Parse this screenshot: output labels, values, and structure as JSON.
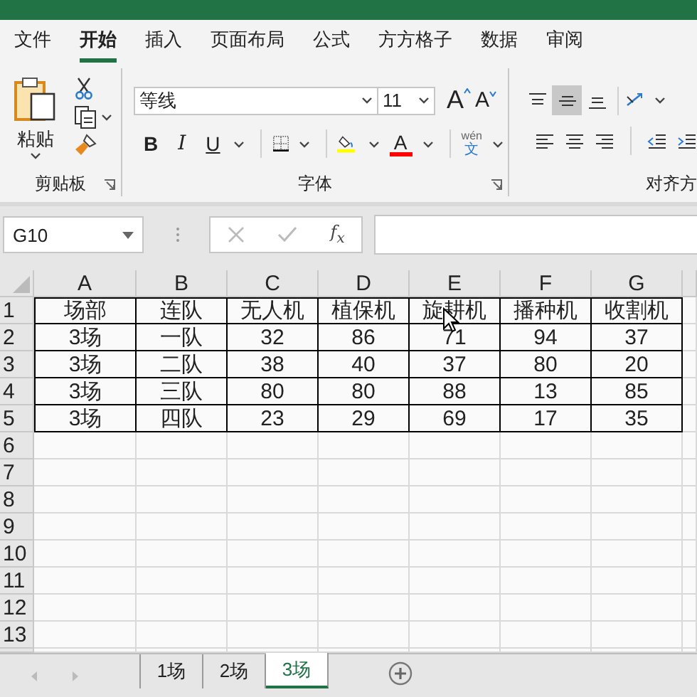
{
  "menu_tabs": [
    {
      "label": "文件",
      "selected": false
    },
    {
      "label": "开始",
      "selected": true
    },
    {
      "label": "插入",
      "selected": false
    },
    {
      "label": "页面布局",
      "selected": false
    },
    {
      "label": "公式",
      "selected": false
    },
    {
      "label": "方方格子",
      "selected": false
    },
    {
      "label": "数据",
      "selected": false
    },
    {
      "label": "审阅",
      "selected": false
    }
  ],
  "ribbon": {
    "clipboard": {
      "paste_label": "粘贴",
      "group_label": "剪贴板"
    },
    "font": {
      "font_name": "等线",
      "font_size": "11",
      "grow_label": "A",
      "shrink_label": "A",
      "bold_label": "B",
      "italic_label": "I",
      "underline_label": "U",
      "font_color_label": "A",
      "phonetic_top": "wén",
      "phonetic_bottom": "文",
      "group_label": "字体"
    },
    "alignment": {
      "vertical": [
        {
          "kind": "top",
          "selected": false
        },
        {
          "kind": "middle",
          "selected": true
        },
        {
          "kind": "bottom",
          "selected": false
        }
      ],
      "group_label": "对齐方"
    }
  },
  "formula_bar": {
    "name_box": "G10",
    "fx_label": "f$_{x}$"
  },
  "sheet": {
    "columns": [
      "A",
      "B",
      "C",
      "D",
      "E",
      "F",
      "G"
    ],
    "row_headers": [
      "1",
      "2",
      "3",
      "4",
      "5",
      "6",
      "7",
      "8",
      "9",
      "10",
      "11",
      "12",
      "13"
    ],
    "rows": [
      [
        "场部",
        "连队",
        "无人机",
        "植保机",
        "旋耕机",
        "播种机",
        "收割机"
      ],
      [
        "3场",
        "一队",
        "32",
        "86",
        "71",
        "94",
        "37"
      ],
      [
        "3场",
        "二队",
        "38",
        "40",
        "37",
        "80",
        "20"
      ],
      [
        "3场",
        "三队",
        "80",
        "80",
        "88",
        "13",
        "85"
      ],
      [
        "3场",
        "四队",
        "23",
        "29",
        "69",
        "17",
        "35"
      ]
    ]
  },
  "sheet_tabs": [
    {
      "label": "1场",
      "selected": false
    },
    {
      "label": "2场",
      "selected": false
    },
    {
      "label": "3场",
      "selected": true
    }
  ]
}
